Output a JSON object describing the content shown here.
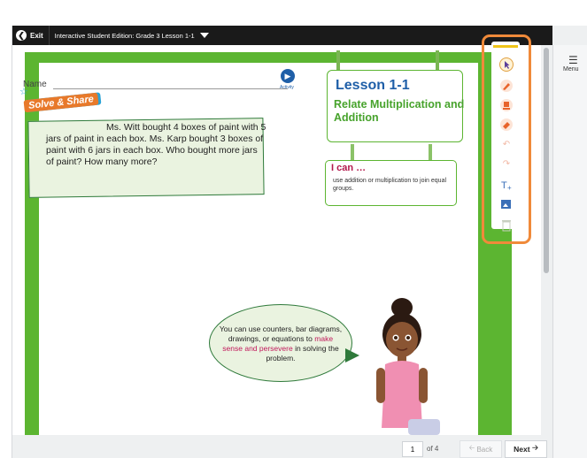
{
  "topbar": {
    "exit_label": "Exit",
    "title": "Interactive Student Edition: Grade 3 Lesson 1-1"
  },
  "worksheet": {
    "name_label": "Name",
    "activity_label": "Activity",
    "solve_share": "Solve & Share",
    "problem": "Ms. Witt bought 4 boxes of paint with 5 jars of paint in each box. Ms. Karp bought 3 boxes of paint with 6 jars in each box. Who bought more jars of paint? How many more?",
    "lesson_title": "Lesson 1-1",
    "lesson_subtitle": "Relate Multiplication and Addition",
    "ican_title": "I can …",
    "ican_text": "use addition or multiplication to join equal groups.",
    "bubble_line1": "You can use counters, bar diagrams, drawings, or equations to",
    "bubble_highlight": "make sense and persevere",
    "bubble_line2": "in solving the problem."
  },
  "tools": [
    {
      "name": "select",
      "icon": "cursor-icon"
    },
    {
      "name": "pen",
      "icon": "pen-icon"
    },
    {
      "name": "highlighter",
      "icon": "highlighter-icon"
    },
    {
      "name": "eraser",
      "icon": "eraser-icon"
    },
    {
      "name": "undo",
      "icon": "undo-icon"
    },
    {
      "name": "redo",
      "icon": "redo-icon"
    },
    {
      "name": "text",
      "icon": "text-tool-icon"
    },
    {
      "name": "image",
      "icon": "image-tool-icon"
    },
    {
      "name": "delete",
      "icon": "trash-icon"
    }
  ],
  "menu": {
    "label": "Menu"
  },
  "pager": {
    "current_page": "1",
    "of_text": "of 4",
    "back_label": "Back",
    "next_label": "Next"
  },
  "colors": {
    "green": "#5cb531",
    "lesson_blue": "#1f5fa8",
    "highlight_orange": "#f08a3a",
    "accent_pink": "#c2185b"
  }
}
